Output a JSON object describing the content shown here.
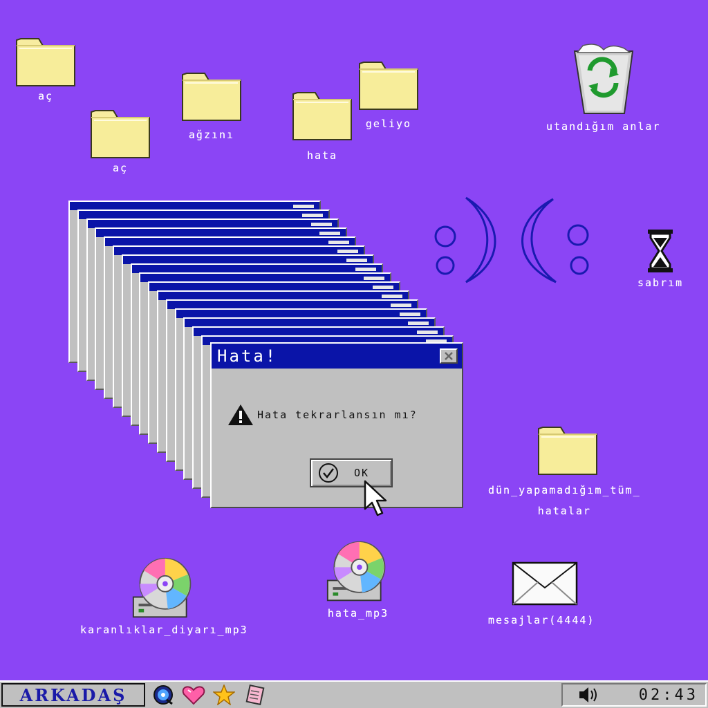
{
  "desktop": {
    "icons": [
      {
        "label": "aç",
        "type": "folder"
      },
      {
        "label": "aç",
        "type": "folder"
      },
      {
        "label": "ağzını",
        "type": "folder"
      },
      {
        "label": "hata",
        "type": "folder"
      },
      {
        "label": "geliyo",
        "type": "folder"
      },
      {
        "label": "utandığım anlar",
        "type": "recycle-bin"
      },
      {
        "label": "sabrım",
        "type": "hourglass"
      },
      {
        "label": "dün_yapamadığım_tüm_",
        "label2": "hatalar",
        "type": "folder"
      },
      {
        "label": "karanlıklar_diyarı_mp3",
        "type": "cd-drive"
      },
      {
        "label": "hata_mp3",
        "type": "cd-drive"
      },
      {
        "label": "mesajlar(4444)",
        "type": "envelope"
      }
    ]
  },
  "dialog": {
    "title": "Hata!",
    "message": "Hata tekrarlansın mı?",
    "ok_label": "OK",
    "stack_count": 16
  },
  "taskbar": {
    "start_label": "ARKADAŞ",
    "tray_icons": [
      "cd-icon",
      "heart-icon",
      "star-icon",
      "notebook-icon"
    ],
    "volume_icon": "speaker-icon",
    "clock": "02:43"
  },
  "colors": {
    "desktop": "#8b45f5",
    "titlebar": "#0a14a8",
    "window": "#c0c0c0",
    "face": "#1a1ab0"
  }
}
